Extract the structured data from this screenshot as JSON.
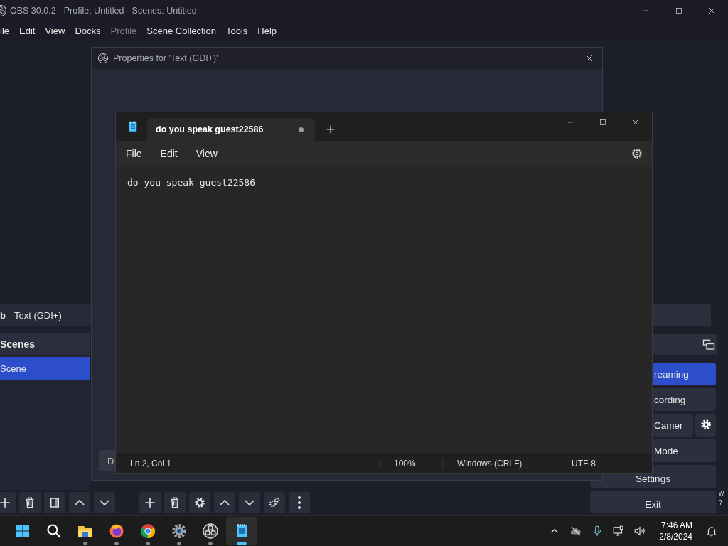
{
  "obs": {
    "title": "OBS 30.0.2 - Profile: Untitled - Scenes: Untitled",
    "menu": [
      {
        "label": "ile",
        "disabled": false
      },
      {
        "label": "Edit",
        "disabled": false
      },
      {
        "label": "View",
        "disabled": false
      },
      {
        "label": "Docks",
        "disabled": false
      },
      {
        "label": "Profile",
        "disabled": true
      },
      {
        "label": "Scene Collection",
        "disabled": false
      },
      {
        "label": "Tools",
        "disabled": false
      },
      {
        "label": "Help",
        "disabled": false
      }
    ],
    "sources_row": {
      "column_1": "b",
      "name": "Text (GDI+)"
    },
    "scenes": {
      "title": "Scenes",
      "items": [
        {
          "label": "Scene",
          "selected": true
        }
      ]
    },
    "controls": [
      {
        "label": "reaming",
        "kind": "primary"
      },
      {
        "label": "cording",
        "kind": "plain"
      },
      {
        "label": "Camer",
        "kind": "with-settings"
      },
      {
        "label": "Mode",
        "kind": "plain"
      },
      {
        "label": "Settings",
        "kind": "wide"
      },
      {
        "label": "Exit",
        "kind": "wide"
      }
    ],
    "edge_fragments": [
      "w",
      "7"
    ]
  },
  "properties_dialog": {
    "title": "Properties for 'Text (GDI+)'",
    "button": "D"
  },
  "notepad": {
    "tab": {
      "title": "do you speak guest22586",
      "unsaved": true,
      "selected": true
    },
    "menu": [
      "File",
      "Edit",
      "View"
    ],
    "text": "do you speak guest22586",
    "status": {
      "position": "Ln 2, Col 1",
      "zoom": "100%",
      "line_endings": "Windows (CRLF)",
      "encoding": "UTF-8"
    }
  },
  "taskbar": {
    "apps": [
      {
        "running": false,
        "active": false
      },
      {
        "running": false,
        "active": false
      },
      {
        "running": true,
        "active": false
      },
      {
        "running": true,
        "active": false
      },
      {
        "running": true,
        "active": false
      },
      {
        "running": true,
        "active": false
      },
      {
        "running": true,
        "active": false
      },
      {
        "running": true,
        "active": true
      }
    ],
    "clock": {
      "time": "7:46 AM",
      "date": "2/8/2024"
    }
  }
}
